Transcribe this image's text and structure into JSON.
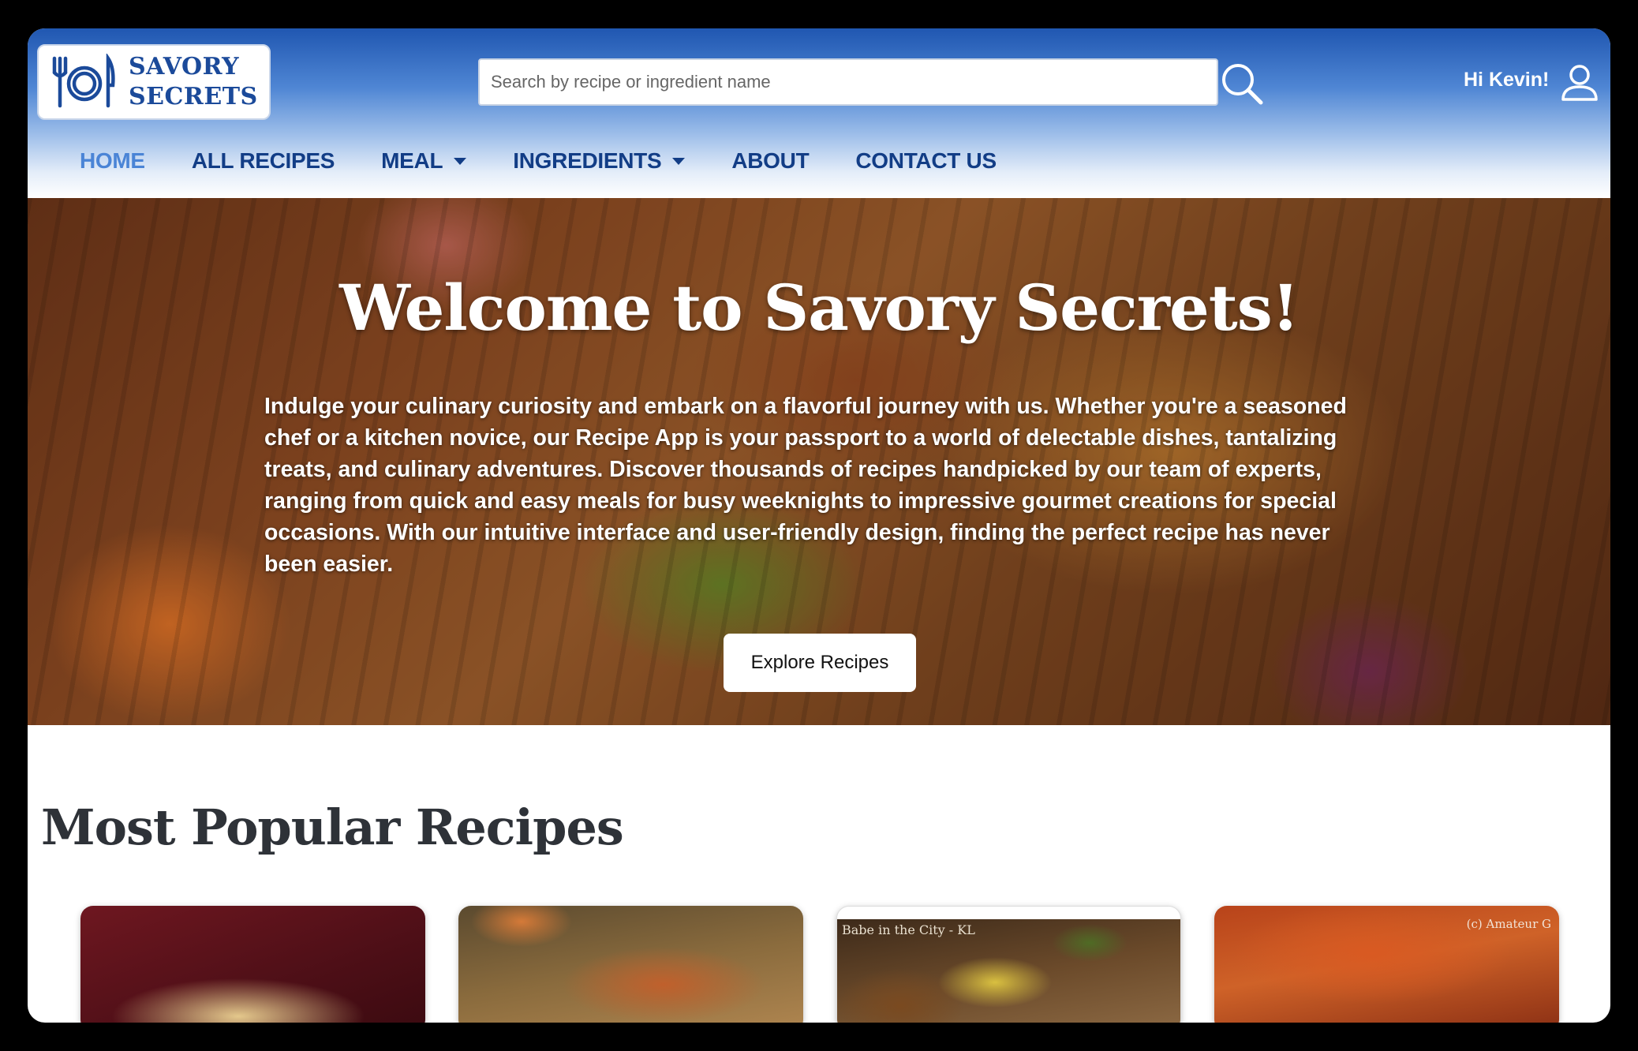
{
  "logo": {
    "line1": "SAVORY",
    "line2": "SECRETS",
    "icon": "plate-fork-knife-icon"
  },
  "search": {
    "placeholder": "Search by recipe or ingredient name",
    "value": "",
    "icon": "search-icon"
  },
  "user": {
    "greeting": "Hi Kevin!",
    "icon": "user-icon"
  },
  "nav": {
    "items": [
      {
        "label": "HOME",
        "active": true,
        "dropdown": false
      },
      {
        "label": "ALL RECIPES",
        "active": false,
        "dropdown": false
      },
      {
        "label": "MEAL",
        "active": false,
        "dropdown": true
      },
      {
        "label": "INGREDIENTS",
        "active": false,
        "dropdown": true
      },
      {
        "label": "ABOUT",
        "active": false,
        "dropdown": false
      },
      {
        "label": "CONTACT US",
        "active": false,
        "dropdown": false
      }
    ]
  },
  "hero": {
    "title": "Welcome to Savory Secrets!",
    "text": "Indulge your culinary curiosity and embark on a flavorful journey with us. Whether you're a seasoned chef or a kitchen novice, our Recipe App is your passport to a world of delectable dishes, tantalizing treats, and culinary adventures. Discover thousands of recipes handpicked by our team of experts, ranging from quick and easy meals for busy weeknights to impressive gourmet creations for special occasions. With our intuitive interface and user-friendly design, finding the perfect recipe has never been easier.",
    "button": "Explore Recipes"
  },
  "popular": {
    "title": "Most Popular Recipes",
    "cards": [
      {
        "watermark": ""
      },
      {
        "watermark": ""
      },
      {
        "watermark": "Babe in the City - KL"
      },
      {
        "watermark": "(c) Amateur G"
      }
    ]
  },
  "colors": {
    "brand": "#1b4a9a",
    "nav": "#123d86",
    "nav_active": "#4a84d6",
    "header_top": "#2057b1"
  }
}
